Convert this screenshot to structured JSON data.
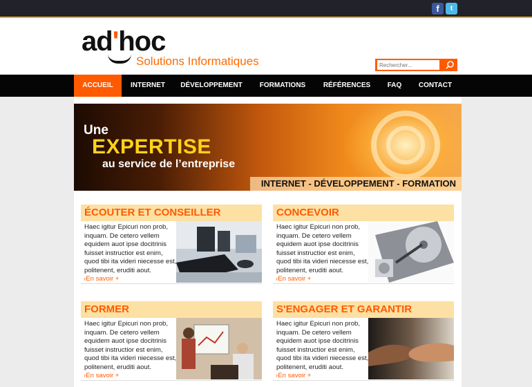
{
  "logo": {
    "main_a": "ad",
    "main_quote": "'",
    "main_b": "hoc",
    "subtitle": "Solutions Informatiques"
  },
  "social": {
    "facebook": "f",
    "twitter": "t"
  },
  "search": {
    "placeholder": "Rechercher..."
  },
  "nav": [
    "ACCUEIL",
    "INTERNET",
    "DÉVELOPPEMENT",
    "FORMATIONS",
    "RÉFÉRENCES",
    "FAQ",
    "CONTACT"
  ],
  "banner": {
    "line1": "Une",
    "line2": "EXPERTISE",
    "line3": "au service de l’entreprise",
    "tagline": "INTERNET - DÉVELOPPEMENT - FORMATION"
  },
  "cards": [
    {
      "title": "ÉCOUTER ET CONSEILLER",
      "text": "Haec igitur Epicuri non prob, inquam. De cetero vellem equidem auot ipse docitrinis fuisset instructior est enim, quod tibi ita videri niecesse est, politenent, eruditi aout.",
      "more": "›En savoir +",
      "image": "computer-keyboard-photo"
    },
    {
      "title": "CONCEVOIR",
      "text": "Haec igitur Epicuri non prob, inquam. De cetero vellem equidem auot ipse docitrinis fuisset instructior est enim, quod tibi ita videri niecesse est, politenent, eruditi aout.",
      "more": "›En savoir +",
      "image": "hard-drive-photo"
    },
    {
      "title": "FORMER",
      "text": "Haec igitur Epicuri non prob, inquam. De cetero vellem equidem auot ipse docitrinis fuisset instructior est enim, quod tibi ita videri niecesse est, politenent, eruditi aout.",
      "more": "›En savoir +",
      "image": "training-meeting-photo"
    },
    {
      "title": "S'ENGAGER ET GARANTIR",
      "text": "Haec igitur Epicuri non prob, inquam. De cetero vellem equidem auot ipse docitrinis fuisset instructior est enim, quod tibi ita videri niecesse est, politenent, eruditi aout.",
      "more": "›En savoir +",
      "image": "handshake-photo"
    }
  ],
  "colors": {
    "accent": "#ff5a00",
    "title_bg": "#fde0a3",
    "nav_bg": "#050505",
    "topbar": "#22222a"
  }
}
